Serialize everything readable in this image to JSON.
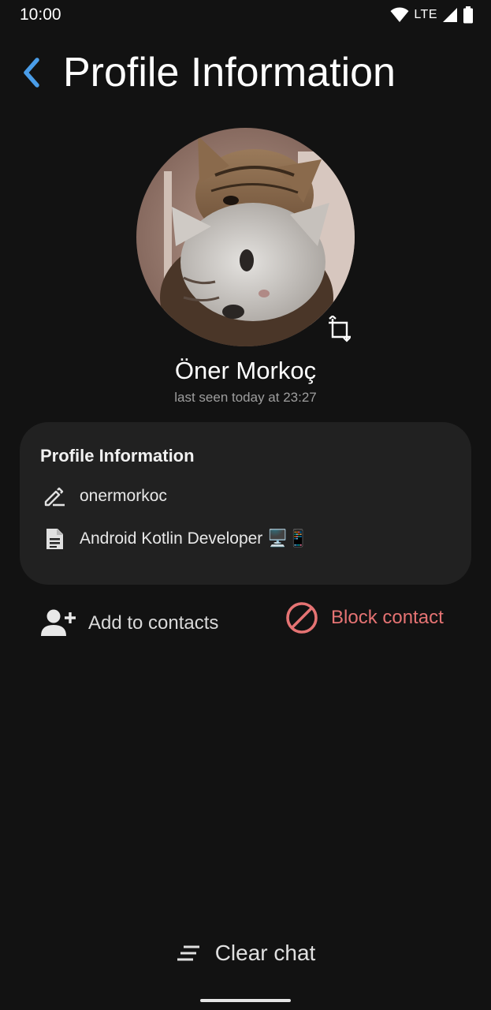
{
  "status_bar": {
    "time": "10:00",
    "network": "LTE"
  },
  "header": {
    "title": "Profile Information"
  },
  "profile": {
    "name": "Öner Morkoç",
    "last_seen": "last seen today at 23:27"
  },
  "info_card": {
    "title": "Profile Information",
    "username": "onermorkoc",
    "bio": "Android Kotlin Developer 🖥️📱"
  },
  "actions": {
    "add_contact": "Add to contacts",
    "block_contact": "Block contact",
    "clear_chat": "Clear chat"
  },
  "colors": {
    "background": "#121212",
    "card": "#212121",
    "accent": "#4a9de8",
    "danger": "#e57373"
  },
  "icons": {
    "back": "chevron-left-icon",
    "rotate": "rotate-icon",
    "username": "pencil-icon",
    "bio": "document-icon",
    "add_contact": "person-add-icon",
    "block_contact": "block-icon",
    "clear_chat": "clear-list-icon"
  }
}
